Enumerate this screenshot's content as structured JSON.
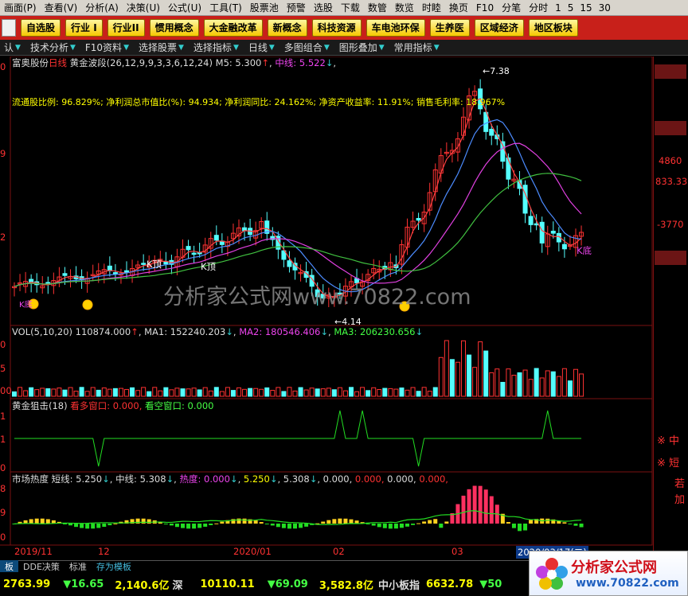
{
  "menu": [
    "画面(P)",
    "查看(V)",
    "分析(A)",
    "决策(U)",
    "公式(U)",
    "工具(T)",
    "股票池",
    "预警",
    "选股",
    "下载",
    "数管",
    "数览",
    "时睦",
    "换页",
    "F10",
    "分笔",
    "分时",
    "1",
    "5",
    "15",
    "30"
  ],
  "buttons": [
    "自选股",
    "行业 I",
    "行业II",
    "惯用概念",
    "大金融改革",
    "新概念",
    "科技资源",
    "车电池环保",
    "生养医",
    "区域经济",
    "地区板块"
  ],
  "tabs": [
    "认",
    "技术分析",
    "F10资料",
    "选择股票",
    "选择指标",
    "日线",
    "多图组合",
    "图形叠加",
    "常用指标"
  ],
  "colors": {
    "up": "#ff3232",
    "down": "#54ffff",
    "ma_white": "#ffffff",
    "ma_red": "#ff4040",
    "ma_blue": "#4c8cff",
    "ma_magenta": "#e040e0",
    "ma_green": "#40c040",
    "watermark": "#888888"
  },
  "main_panel": {
    "stock_name": "富奥股份",
    "period": "日线",
    "indicator": "黄金波段",
    "params": "(26,12,9,9,3,3,6,12,24)",
    "m5_label": "M5: 5.300",
    "mid_label": "中线: 5.522",
    "info_text": "流通股比例: 96.829%; 净利润总市值比(%): 94.934; 净利润同比: 24.162%; 净资产收益率: 11.91%; 销售毛利率: 18.967%",
    "high_label": "7.38",
    "low_label": "4.14",
    "k_top": "K顶",
    "k_bottom": "K底",
    "left_axis": [
      "0",
      "9",
      "2"
    ],
    "right_axis": [
      "4860",
      "833.33",
      "-3770"
    ]
  },
  "watermark": "分析家公式网www.70822.com",
  "vol_panel": {
    "label": "VOL(5,10,20)",
    "vol": "110874.000",
    "ma1": "MA1: 152240.203",
    "ma2": "MA2: 180546.406",
    "ma3": "MA3: 206230.656",
    "left_axis": [
      "0",
      "5",
      "00"
    ]
  },
  "gold_panel": {
    "label": "黄金狙击(18)",
    "bull": "看多窗口: 0.000,",
    "bear": "看空窗口: 0.000",
    "left_axis": [
      "1",
      "1",
      "0"
    ],
    "right_text": [
      "※ 中",
      "※ 短"
    ]
  },
  "heat_panel": {
    "label": "市场热度",
    "short": "短线: 5.250",
    "mid": "中线: 5.308",
    "heat": "热度: 0.000",
    "v1": "5.250",
    "v2": "5.308",
    "v3": "0.000,",
    "v4": "0.000,",
    "v5": "0.000,",
    "v6": "0.000,",
    "left_axis": [
      "8",
      "9",
      "0"
    ],
    "right_text": [
      "若",
      "加"
    ]
  },
  "date_axis": [
    "2019/11",
    "12",
    "2020/01",
    "02",
    "03",
    "2020/03/17(二)"
  ],
  "status": [
    "板",
    "DDE决策",
    "标准",
    "存为模板"
  ],
  "quotes": {
    "q1": "2763.99",
    "q2": "16.65",
    "q3": "2,140.6亿",
    "q4": "深",
    "q5": "10110.11",
    "q6": "69.09",
    "q7": "3,582.8亿",
    "q8": "中小板指",
    "q9": "6632.78",
    "q10": "50"
  },
  "logo": {
    "title": "分析家公式网",
    "url": "www.70822.com"
  }
}
